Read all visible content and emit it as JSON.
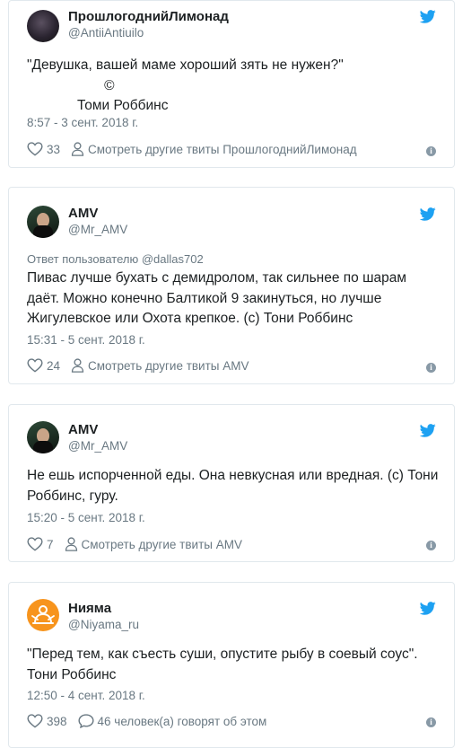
{
  "tweets": [
    {
      "name": "ПрошлогоднийЛимонад",
      "handle": "@AntiiAntiuilo",
      "text": "\"Девушка, вашей маме хороший зять не нужен?\"\n                    ©\n             Томи Роббинс",
      "timestamp": "8:57 - 3 сент. 2018 г.",
      "likes": "33",
      "profile_link": "Смотреть другие твиты ПрошлогоднийЛимонад",
      "avatar": "dark-avatar"
    },
    {
      "name": "AMV",
      "handle": "@Mr_AMV",
      "reply_to": "Ответ пользователю @dallas702",
      "text": "Пивас лучше бухать с демидролом, так сильнее по шарам даёт. Можно конечно Балтикой 9 закинуться, но лучше Жигулевское или Охота крепкое. (с) Тони Роббинс",
      "timestamp": "15:31 - 5 сент. 2018 г.",
      "likes": "24",
      "profile_link": "Смотреть другие твиты AMV",
      "avatar": "amv-avatar"
    },
    {
      "name": "AMV",
      "handle": "@Mr_AMV",
      "text": "Не ешь испорченной еды. Она невкусная или вредная. (с) Тони Роббинс, гуру.",
      "timestamp": "15:20 - 5 сент. 2018 г.",
      "likes": "7",
      "profile_link": "Смотреть другие твиты AMV",
      "avatar": "amv-avatar"
    },
    {
      "name": "Нияма",
      "handle": "@Niyama_ru",
      "text": "\"Перед тем, как съесть суши, опустите рыбу в соевый соус\". Тони Роббинс",
      "timestamp": "12:50 - 4 сент. 2018 г.",
      "likes": "398",
      "comments_text": "46 человек(а) говорят об этом",
      "avatar": "niyama-logo"
    }
  ],
  "icons": {
    "bird": "twitter-bird-icon",
    "heart": "heart-icon",
    "profile": "person-icon",
    "comment": "speech-bubble-icon",
    "info": "info-icon",
    "info_glyph": "i"
  },
  "colors": {
    "twitter_blue": "#1da1f2",
    "secondary_text": "#697882",
    "border": "#e1e8ed",
    "niyama_orange": "#f7941d"
  }
}
